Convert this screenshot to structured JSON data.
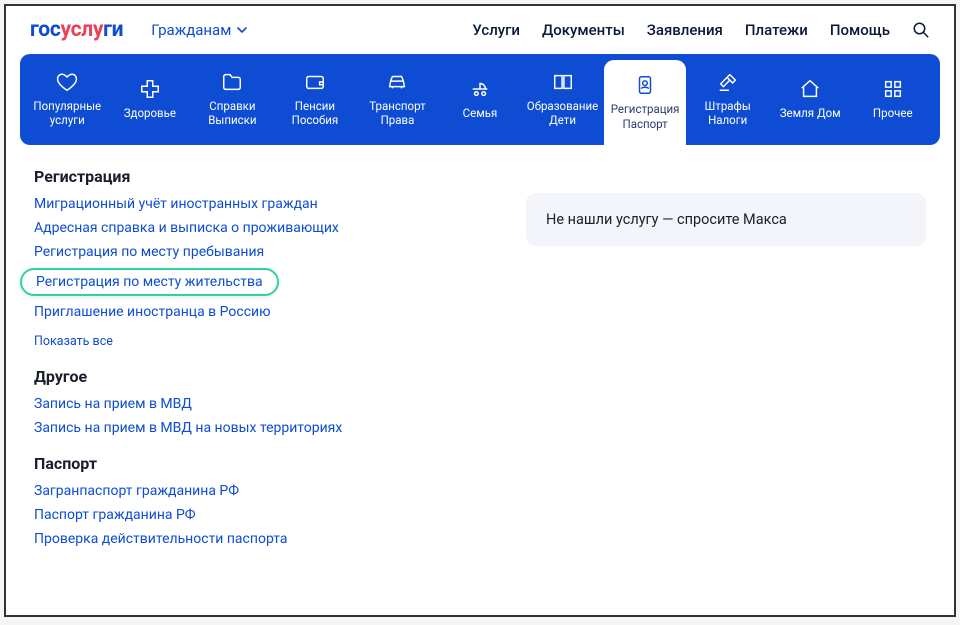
{
  "header": {
    "logo_gos": "гос",
    "logo_usl": "услу",
    "logo_gi": "ги",
    "citizens_label": "Гражданам",
    "nav": {
      "services": "Услуги",
      "documents": "Документы",
      "applications": "Заявления",
      "payments": "Платежи",
      "help": "Помощь"
    }
  },
  "categories": [
    {
      "label": "Популярные услуги",
      "icon": "heart"
    },
    {
      "label": "Здоровье",
      "icon": "plus-medical"
    },
    {
      "label": "Справки Выписки",
      "icon": "folder"
    },
    {
      "label": "Пенсии Пособия",
      "icon": "wallet"
    },
    {
      "label": "Транспорт Права",
      "icon": "car"
    },
    {
      "label": "Семья",
      "icon": "stroller"
    },
    {
      "label": "Образование Дети",
      "icon": "book"
    },
    {
      "label": "Регистрация Паспорт",
      "icon": "passport",
      "active": true
    },
    {
      "label": "Штрафы Налоги",
      "icon": "gavel"
    },
    {
      "label": "Земля Дом",
      "icon": "house"
    },
    {
      "label": "Прочее",
      "icon": "grid"
    }
  ],
  "sections": {
    "registration": {
      "title": "Регистрация",
      "items": [
        "Миграционный учёт иностранных граждан",
        "Адресная справка и выписка о проживающих",
        "Регистрация по месту пребывания",
        "Регистрация по месту жительства",
        "Приглашение иностранца в Россию"
      ],
      "highlighted_index": 3,
      "show_all": "Показать все"
    },
    "other": {
      "title": "Другое",
      "items": [
        "Запись на прием в МВД",
        "Запись на прием в МВД на новых территориях"
      ]
    },
    "passport": {
      "title": "Паспорт",
      "items": [
        "Загранпаспорт гражданина РФ",
        "Паспорт гражданина РФ",
        "Проверка действительности паспорта"
      ]
    }
  },
  "max_prompt": "Не нашли услугу — спросите Макса"
}
